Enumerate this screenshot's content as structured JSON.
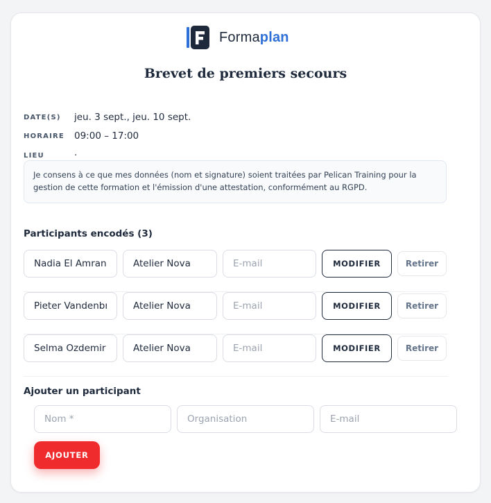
{
  "brand": {
    "name_prefix": "Forma",
    "name_suffix": "plan",
    "accent_color": "#2f6fd8"
  },
  "course": {
    "title": "Brevet de premiers secours",
    "dates_label": "DATE(S)",
    "dates_value": "jeu. 3 sept., jeu. 10 sept.",
    "schedule_label": "HORAIRE",
    "schedule_value": "09:00 – 17:00",
    "location_label": "LIEU",
    "location_value": "·"
  },
  "consent_text": "Je consens à ce que mes données (nom et signature) soient traitées par Pelican Training pour la gestion de cette formation et l'émission d'une attestation, conformément au RGPD.",
  "participants": {
    "title": "Participants encodés (3)",
    "email_placeholder": "E-mail",
    "modify_label": "MODIFIER",
    "remove_label": "Retirer",
    "rows": [
      {
        "name": "Nadia El Amrani",
        "organisation": "Atelier Nova",
        "email": ""
      },
      {
        "name": "Pieter Vandenbroucke",
        "organisation": "Atelier Nova",
        "email": ""
      },
      {
        "name": "Selma Ozdemir",
        "organisation": "Atelier Nova",
        "email": ""
      }
    ]
  },
  "add_participant": {
    "title": "Ajouter un participant",
    "name_placeholder": "Nom *",
    "organisation_placeholder": "Organisation",
    "email_placeholder": "E-mail",
    "submit_label": "AJOUTER",
    "submit_color": "#ef2b2d"
  }
}
